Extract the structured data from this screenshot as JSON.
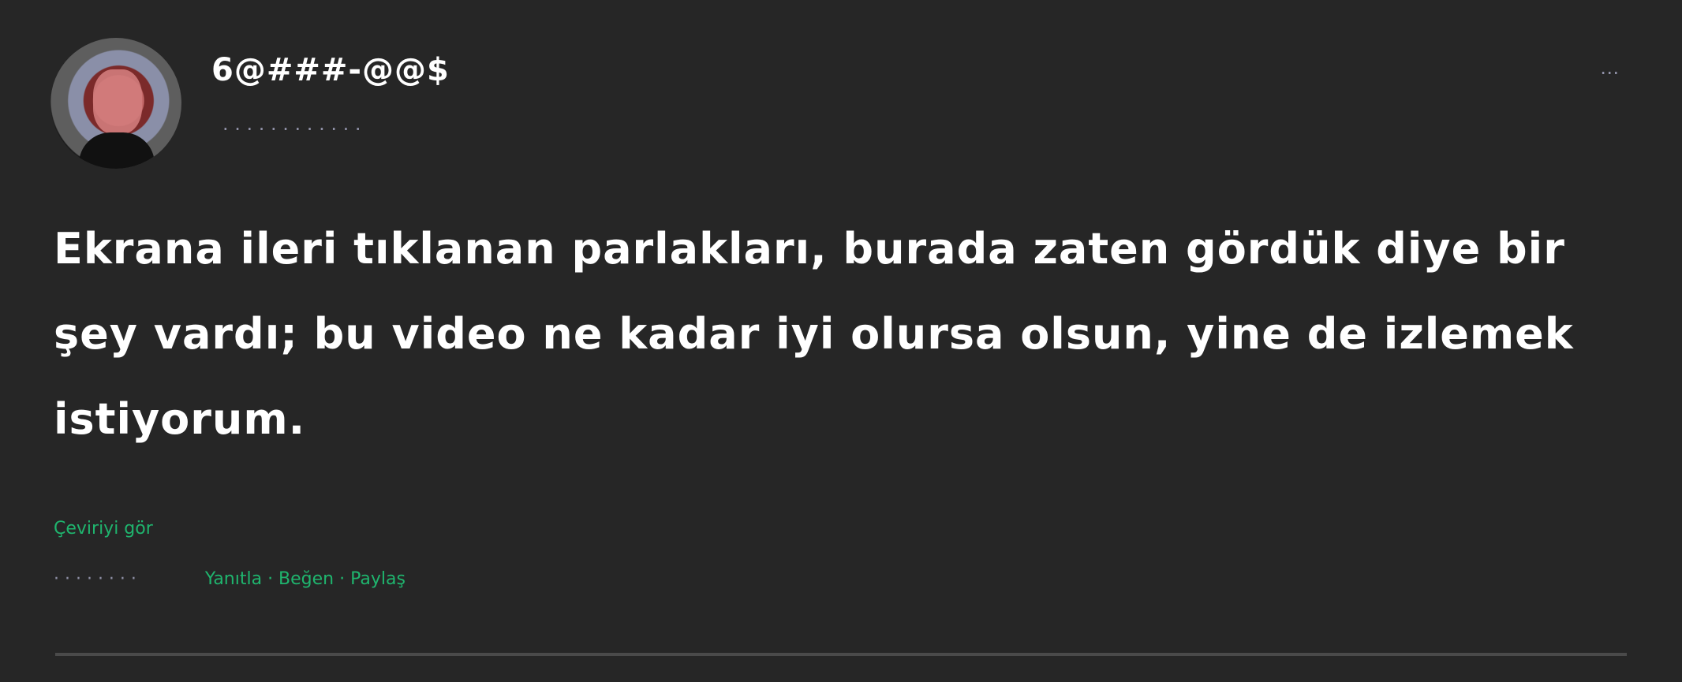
{
  "post": {
    "username": "6@###-@@$",
    "meta_text": "· · · · · · · · · · · ·",
    "message": "Ekrana ileri tıklanan parlakları, burada zaten gördük diye bir şey vardı; bu video ne kadar iyi olursa olsun, yine de izlemek istiyorum.",
    "translation_label": "Çeviriyi gör",
    "footer_info": "· · ·  · · · · ·",
    "footer_green": "Yanıtla · Beğen · Paylaş"
  },
  "colors": {
    "background": "#262626",
    "text": "#ffffff",
    "muted": "#8f90a6",
    "accent_green": "#1fb56e",
    "divider": "#4a4a4a"
  },
  "icons": {
    "more": "more-options-icon"
  }
}
